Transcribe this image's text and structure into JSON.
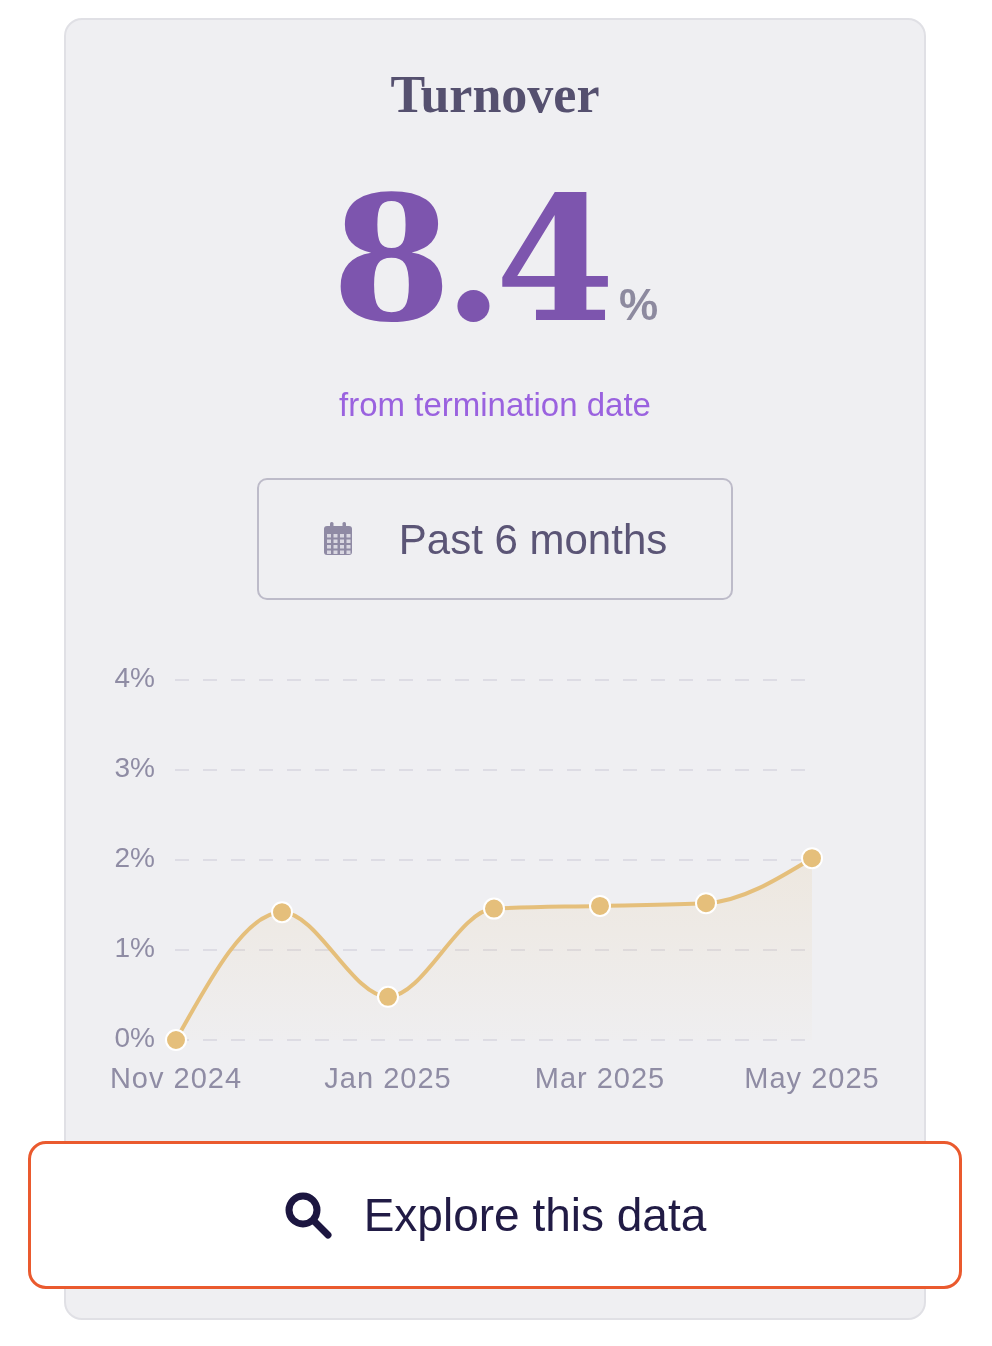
{
  "card": {
    "title": "Turnover",
    "metric": {
      "value": "8.4",
      "unit": "%"
    },
    "subtitle": "from termination date",
    "date_range": {
      "label": "Past 6 months"
    },
    "chart_data": {
      "type": "area",
      "categories": [
        "Nov 2024",
        null,
        "Jan 2025",
        null,
        "Mar 2025",
        null,
        "May 2025"
      ],
      "ylim": [
        0,
        4
      ],
      "yticks": [
        {
          "value": 4,
          "label": "4%"
        },
        {
          "value": 3,
          "label": "3%"
        },
        {
          "value": 2,
          "label": "2%"
        },
        {
          "value": 1,
          "label": "1%"
        },
        {
          "value": 0,
          "label": "0%"
        }
      ],
      "grid": true,
      "series": [
        {
          "color": "#e5bf7b",
          "values": [
            0,
            1.42,
            0.48,
            1.46,
            1.49,
            1.52,
            2.02
          ]
        }
      ]
    },
    "action": {
      "label": "Explore this data"
    }
  }
}
